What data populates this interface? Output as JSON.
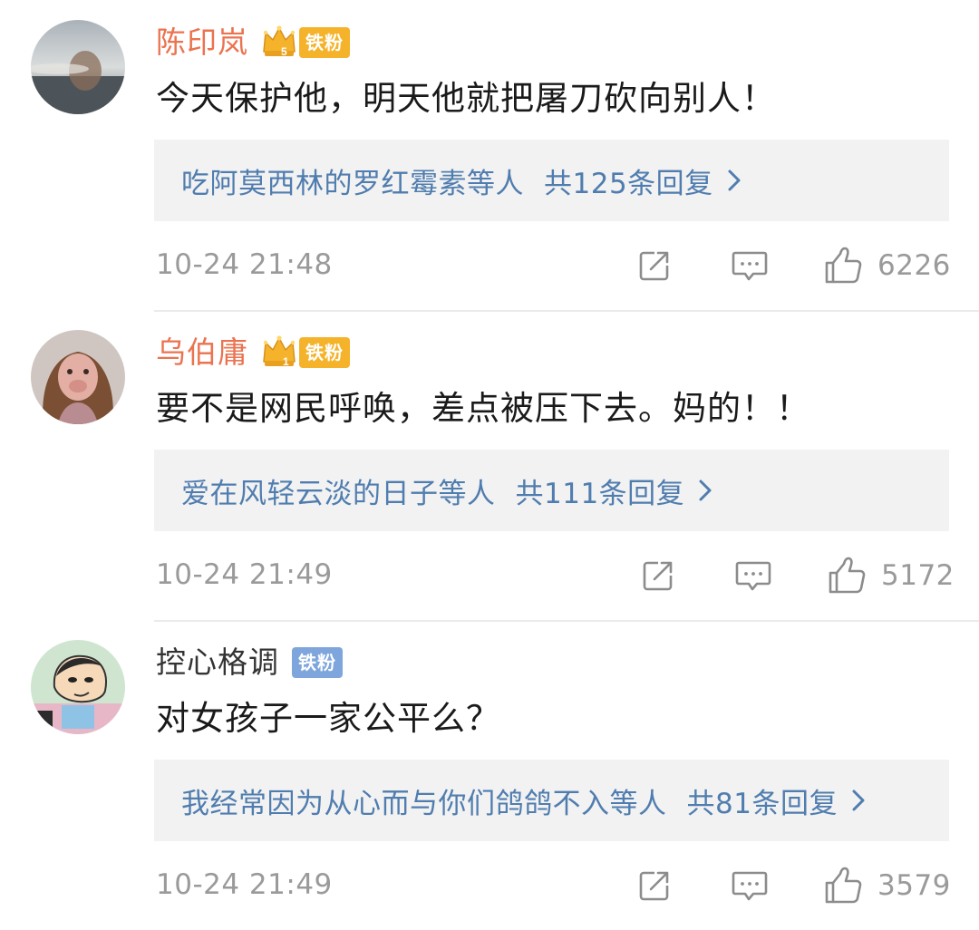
{
  "comments": [
    {
      "name": "陈印岚",
      "fan_badge": "铁粉",
      "crown_level": "5",
      "text": "今天保护他，明天他就把屠刀砍向别人！",
      "reply_users": "吃阿莫西林的罗红霉素等人",
      "reply_count": "共125条回复",
      "time": "10-24 21:48",
      "likes": "6226"
    },
    {
      "name": "乌伯庸",
      "fan_badge": "铁粉",
      "crown_level": "1",
      "text": "要不是网民呼唤，差点被压下去。妈的！！",
      "reply_users": "爱在风轻云淡的日子等人",
      "reply_count": "共111条回复",
      "time": "10-24 21:49",
      "likes": "5172"
    },
    {
      "name": "控心格调",
      "fan_badge": "铁粉",
      "text": "对女孩子一家公平么？",
      "reply_users": "我经常因为从心而与你们鸽鸽不入等人",
      "reply_count": "共81条回复",
      "time": "10-24 21:49",
      "likes": "3579"
    }
  ],
  "icons": {
    "share": "share-icon",
    "comment": "comment-icon",
    "like": "thumbs-up-icon",
    "crown": "crown-icon",
    "chevron": "chevron-right-icon"
  },
  "colors": {
    "username_vip": "#eb7350",
    "username_normal": "#333333",
    "link_blue": "#507daf",
    "meta_gray": "#9a9a9a",
    "reply_bg": "#f2f2f2",
    "badge_gold": "#f5b32b",
    "badge_blue": "#7fa6dc"
  }
}
